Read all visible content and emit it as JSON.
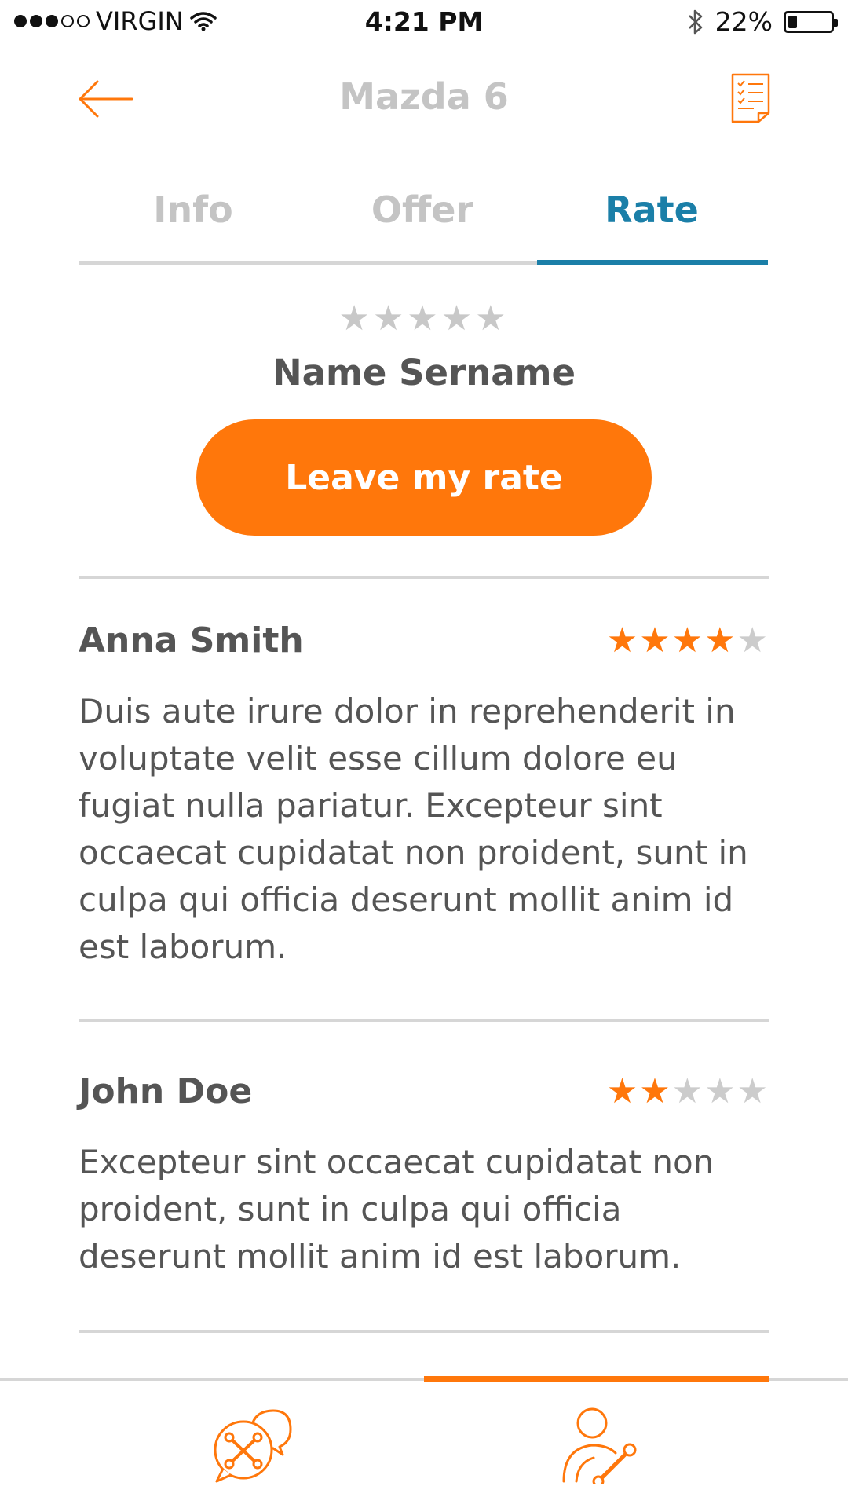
{
  "status_bar": {
    "carrier": "VIRGIN",
    "time": "4:21 PM",
    "battery": "22%",
    "battery_level": 0.22
  },
  "header": {
    "title": "Mazda 6",
    "back_icon": "arrow-left-icon",
    "action_icon": "checklist-document-icon"
  },
  "tabs": [
    {
      "label": "Info",
      "active": false
    },
    {
      "label": "Offer",
      "active": false
    },
    {
      "label": "Rate",
      "active": true
    }
  ],
  "rate_section": {
    "stars": "★★★★★",
    "user_name": "Name Sername",
    "button_label": "Leave my rate"
  },
  "reviews": [
    {
      "name": "Anna Smith",
      "rating": 4,
      "max_rating": 5,
      "text": "Duis aute irure dolor in reprehenderit in voluptate velit esse cillum dolore eu fugiat nulla pariatur. Excepteur sint occaecat cupidatat non proident, sunt in culpa qui officia deserunt mollit anim id est laborum."
    },
    {
      "name": "John Doe",
      "rating": 2,
      "max_rating": 5,
      "text": "Excepteur sint occaecat cupidatat non proident, sunt in culpa qui officia deserunt mollit anim id est laborum."
    }
  ],
  "bottom_nav": {
    "items": [
      {
        "icon": "chat-wrench-icon",
        "active": false
      },
      {
        "icon": "mechanic-profile-icon",
        "active": true
      }
    ]
  },
  "colors": {
    "accent": "#ff770b",
    "tab_active": "#1b7fa8",
    "muted": "#c4c4c4",
    "text": "#555555"
  }
}
